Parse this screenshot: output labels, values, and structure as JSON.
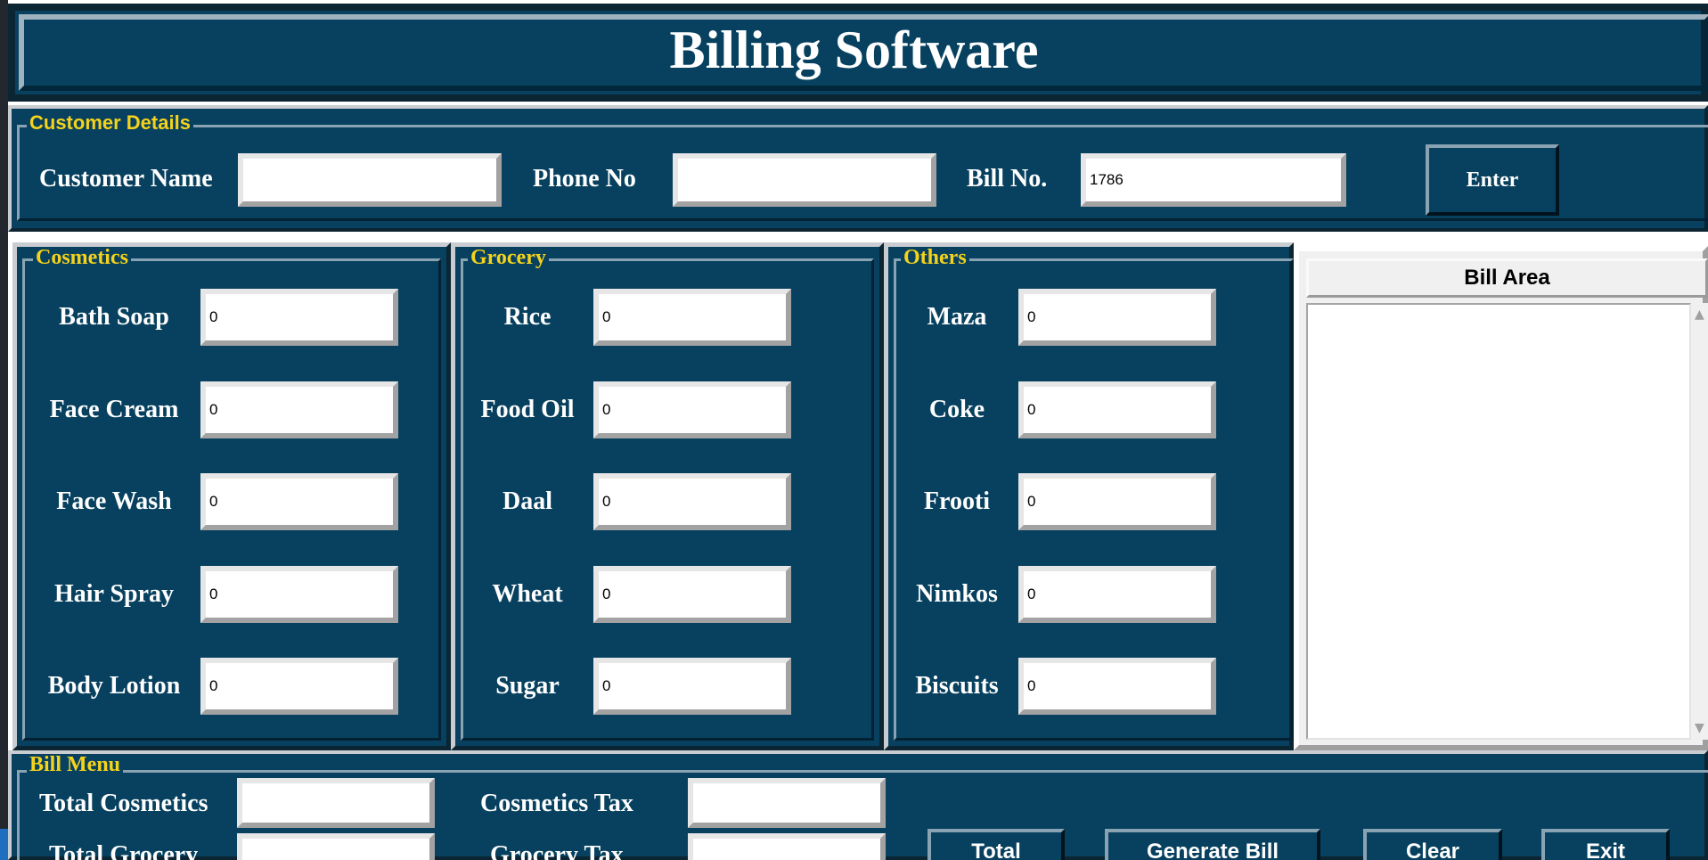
{
  "title": "Billing Software",
  "customer": {
    "legend": "Customer Details",
    "name_label": "Customer Name",
    "name_value": "",
    "phone_label": "Phone No",
    "phone_value": "",
    "bill_label": "Bill No.",
    "bill_value": "1786",
    "enter_label": "Enter"
  },
  "cosmetics": {
    "legend": "Cosmetics",
    "items": [
      {
        "label": "Bath Soap",
        "value": "0"
      },
      {
        "label": "Face Cream",
        "value": "0"
      },
      {
        "label": "Face Wash",
        "value": "0"
      },
      {
        "label": "Hair Spray",
        "value": "0"
      },
      {
        "label": "Body Lotion",
        "value": "0"
      }
    ]
  },
  "grocery": {
    "legend": "Grocery",
    "items": [
      {
        "label": "Rice",
        "value": "0"
      },
      {
        "label": "Food Oil",
        "value": "0"
      },
      {
        "label": "Daal",
        "value": "0"
      },
      {
        "label": "Wheat",
        "value": "0"
      },
      {
        "label": "Sugar",
        "value": "0"
      }
    ]
  },
  "others": {
    "legend": "Others",
    "items": [
      {
        "label": "Maza",
        "value": "0"
      },
      {
        "label": "Coke",
        "value": "0"
      },
      {
        "label": "Frooti",
        "value": "0"
      },
      {
        "label": "Nimkos",
        "value": "0"
      },
      {
        "label": "Biscuits",
        "value": "0"
      }
    ]
  },
  "bill_area": {
    "header": "Bill Area",
    "content": ""
  },
  "bill_menu": {
    "legend": "Bill Menu",
    "total_cosmetics_label": "Total Cosmetics",
    "total_cosmetics_value": "",
    "cosmetics_tax_label": "Cosmetics Tax",
    "cosmetics_tax_value": "",
    "total_grocery_label": "Total Grocery",
    "total_grocery_value": "",
    "grocery_tax_label": "Grocery Tax",
    "grocery_tax_value": "",
    "buttons": {
      "total": "Total",
      "generate": "Generate Bill",
      "clear": "Clear",
      "exit": "Exit"
    }
  },
  "icons": {
    "scroll_up": "▲",
    "scroll_down": "▼"
  },
  "colors": {
    "panel_bg": "#07415f",
    "legend_text": "#f5d21b",
    "label_text": "#ffffff"
  }
}
